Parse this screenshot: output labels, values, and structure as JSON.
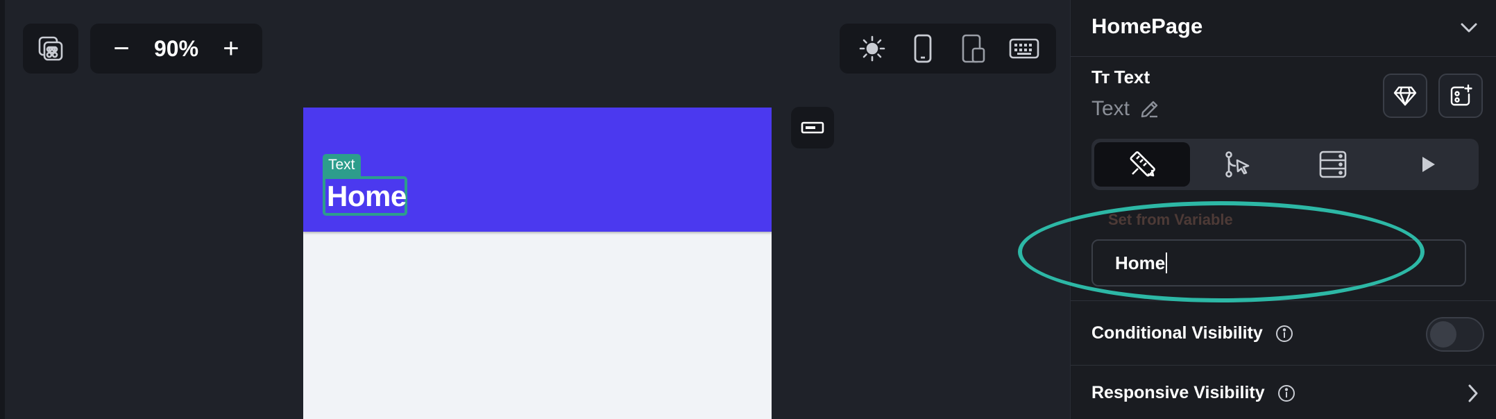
{
  "toolbar": {
    "zoom_value": "90%",
    "zoom_out_label": "−",
    "zoom_in_label": "+",
    "icons": [
      "command-icon",
      "sun-icon",
      "phone-icon",
      "tablet-icon",
      "keyboard-icon"
    ]
  },
  "canvas": {
    "selection_tag": "Text",
    "app_bar_title": "Home",
    "app_bar_color": "#4b39ef",
    "selection_color": "#2d9d8c",
    "page_bg": "#f1f3f7"
  },
  "panel": {
    "page_name": "HomePage",
    "widget_type_icon": "Tт",
    "widget_type_label": "Text",
    "widget_name": "Text",
    "tabs": [
      {
        "icon": "properties-icon",
        "active": true
      },
      {
        "icon": "actions-icon",
        "active": false
      },
      {
        "icon": "backend-query-icon",
        "active": false
      },
      {
        "icon": "play-icon",
        "active": false
      }
    ],
    "set_from_variable_label": "Set from Variable",
    "text_value": "Home",
    "conditional_visibility_label": "Conditional Visibility",
    "conditional_visibility_on": false,
    "responsive_visibility_label": "Responsive Visibility"
  },
  "annotation": {
    "ellipse_color": "#2db8a6"
  }
}
